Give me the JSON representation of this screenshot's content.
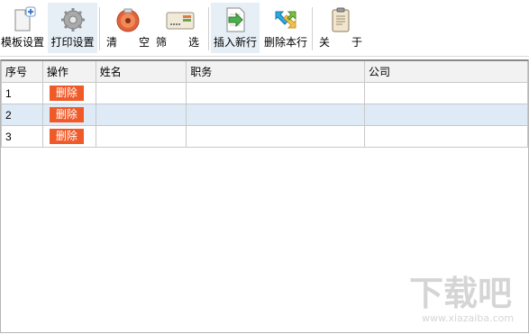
{
  "toolbar": {
    "template_settings": "模板设置",
    "print_settings": "打印设置",
    "clear_1": "清",
    "clear_2": "空",
    "filter_1": "筛",
    "filter_2": "选",
    "insert_row": "插入新行",
    "delete_row": "删除本行",
    "about_1": "关",
    "about_2": "于"
  },
  "table": {
    "headers": [
      "序号",
      "操作",
      "姓名",
      "职务",
      "公司"
    ],
    "rows": [
      {
        "no": "1",
        "action": "删除",
        "name": "",
        "title": "",
        "company": ""
      },
      {
        "no": "2",
        "action": "删除",
        "name": "",
        "title": "",
        "company": ""
      },
      {
        "no": "3",
        "action": "删除",
        "name": "",
        "title": "",
        "company": ""
      }
    ],
    "selected_row": 2
  },
  "watermark": {
    "text": "下载吧",
    "url": "www.xiazaiba.com"
  },
  "colors": {
    "delete_button": "#f05a28",
    "selected_row": "#dfeaf7",
    "toolbar_active": "#e6eef6"
  }
}
